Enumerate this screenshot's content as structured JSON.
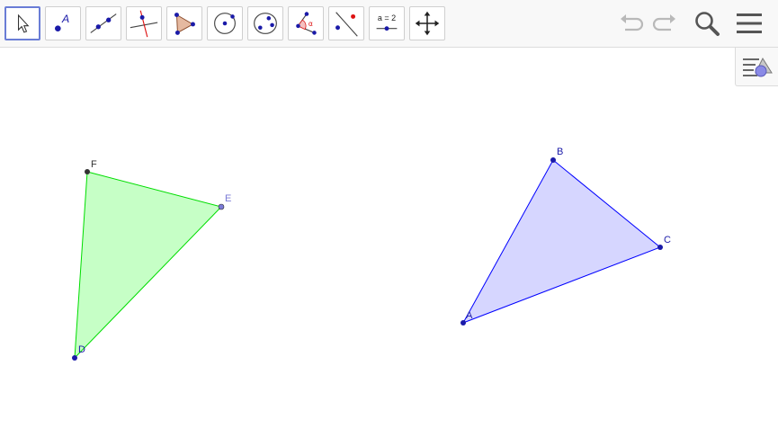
{
  "toolbar": {
    "tools": [
      {
        "name": "move-tool"
      },
      {
        "name": "point-tool",
        "glyph": "A"
      },
      {
        "name": "line-tool"
      },
      {
        "name": "perpendicular-line-tool"
      },
      {
        "name": "polygon-tool"
      },
      {
        "name": "circle-tool"
      },
      {
        "name": "conic-tool"
      },
      {
        "name": "angle-tool",
        "glyph": "α"
      },
      {
        "name": "reflect-tool"
      },
      {
        "name": "slider-tool",
        "glyph": "a = 2"
      },
      {
        "name": "move-graphics-view-tool"
      }
    ],
    "right": [
      "undo-icon",
      "redo-icon",
      "search-icon",
      "menu-icon"
    ]
  },
  "graphics": {
    "points": {
      "A": {
        "label": "A"
      },
      "B": {
        "label": "B"
      },
      "C": {
        "label": "C"
      },
      "D": {
        "label": "D"
      },
      "E": {
        "label": "E"
      },
      "F": {
        "label": "F"
      }
    },
    "polygons": [
      {
        "name": "triangle-abc",
        "vertices": [
          "A",
          "B",
          "C"
        ],
        "fill": "#d6d6ff",
        "stroke": "#0000ff"
      },
      {
        "name": "triangle-def",
        "vertices": [
          "D",
          "E",
          "F"
        ],
        "fill": "#c6ffc6",
        "stroke": "#00dd00"
      }
    ],
    "colors": {
      "point_blue": "#1a1aa8",
      "point_free": "#7a7ad6",
      "point_dark": "#333333"
    }
  }
}
